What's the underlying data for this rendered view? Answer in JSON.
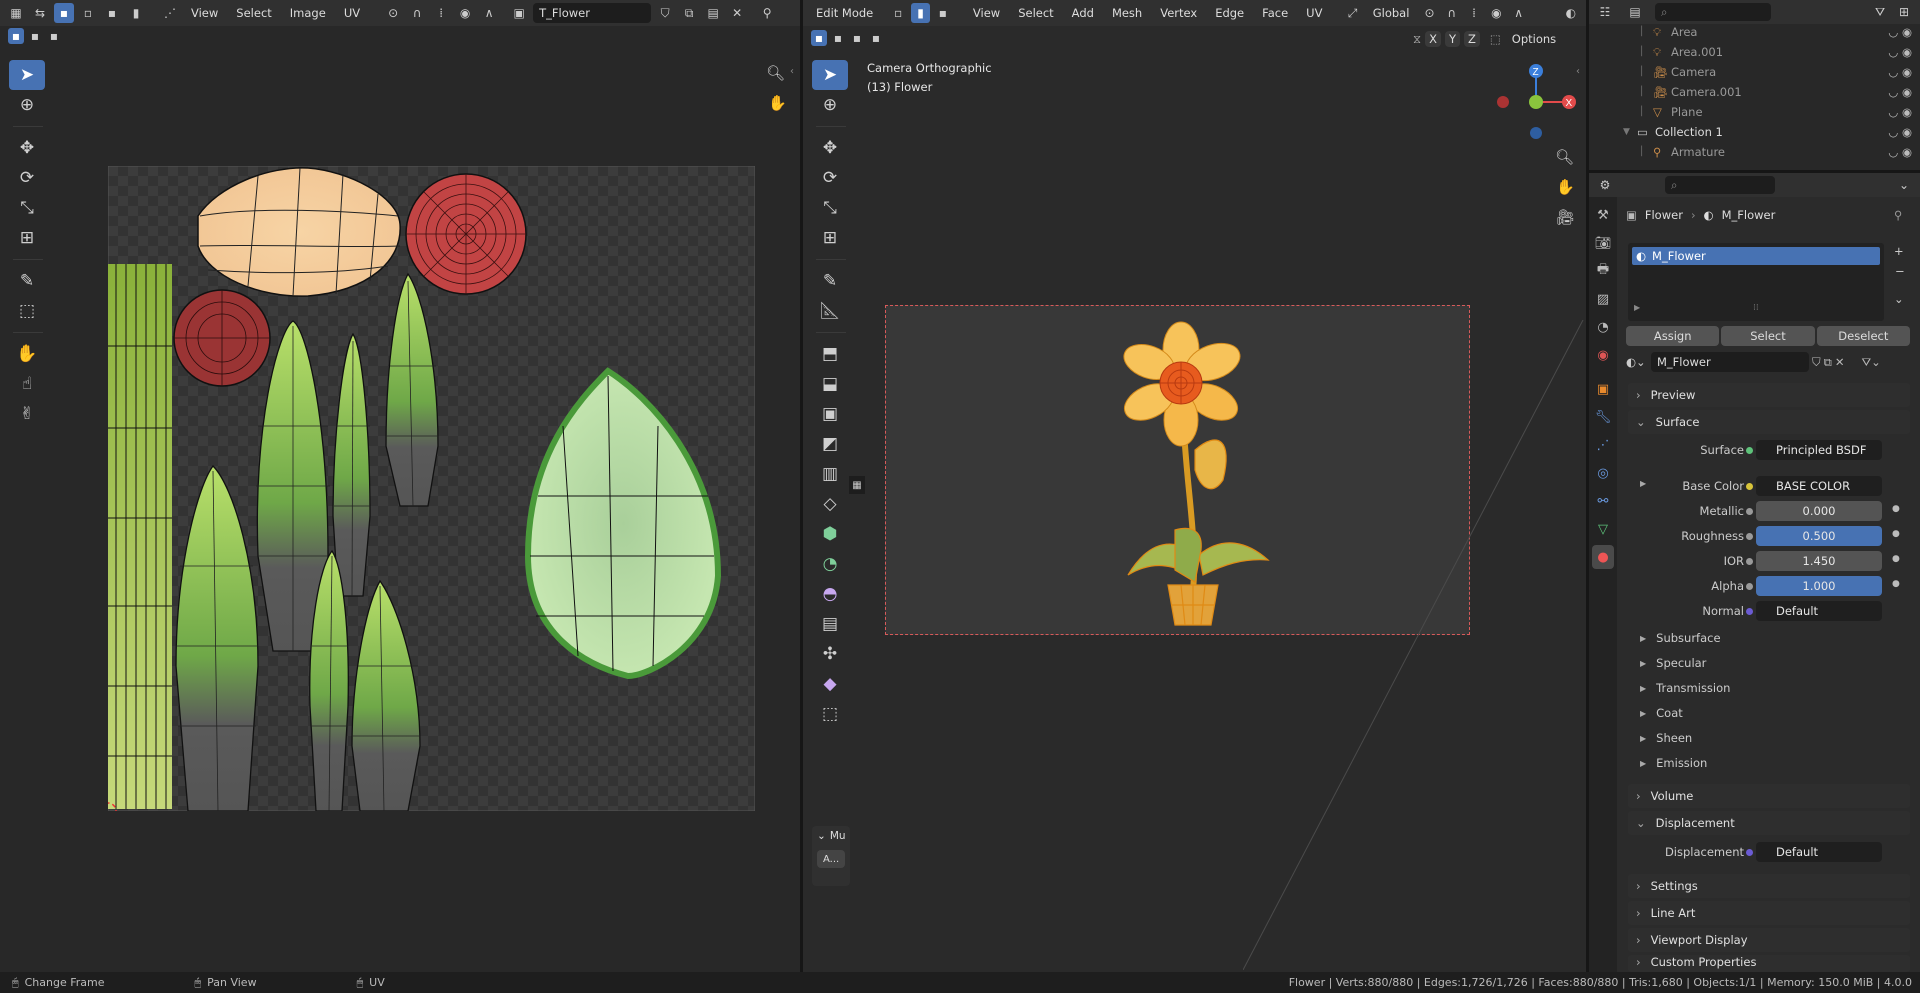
{
  "uv_editor": {
    "menus": [
      "View",
      "Select",
      "Image",
      "UV"
    ],
    "image_name": "T_Flower"
  },
  "viewport": {
    "mode": "Edit Mode",
    "menus": [
      "View",
      "Select",
      "Add",
      "Mesh",
      "Vertex",
      "Edge",
      "Face",
      "UV"
    ],
    "orientation": "Global",
    "options": "Options",
    "axis_x": "X",
    "axis_y": "Y",
    "axis_z": "Z",
    "camera_label": "Camera Orthographic",
    "object_label": "(13) Flower",
    "panel_title": "Mu",
    "panel_button": "A..."
  },
  "outliner": {
    "items": [
      {
        "name": "Area",
        "indent": 1
      },
      {
        "name": "Area.001",
        "indent": 1
      },
      {
        "name": "Camera",
        "indent": 1
      },
      {
        "name": "Camera.001",
        "indent": 1
      },
      {
        "name": "Plane",
        "indent": 1
      },
      {
        "name": "Collection 1",
        "indent": 0
      },
      {
        "name": "Armature",
        "indent": 1
      }
    ]
  },
  "properties": {
    "breadcrumb_object": "Flower",
    "breadcrumb_material": "M_Flower",
    "slot": "M_Flower",
    "assign": "Assign",
    "select": "Select",
    "deselect": "Deselect",
    "material_name": "M_Flower",
    "preview": "Preview",
    "surface_section": "Surface",
    "surface_label": "Surface",
    "surface_value": "Principled BSDF",
    "base_color_label": "Base Color",
    "base_color_value": "BASE COLOR",
    "metallic_label": "Metallic",
    "metallic_value": "0.000",
    "roughness_label": "Roughness",
    "roughness_value": "0.500",
    "ior_label": "IOR",
    "ior_value": "1.450",
    "alpha_label": "Alpha",
    "alpha_value": "1.000",
    "normal_label": "Normal",
    "normal_value": "Default",
    "subsections": [
      "Subsurface",
      "Specular",
      "Transmission",
      "Coat",
      "Sheen",
      "Emission"
    ],
    "volume": "Volume",
    "displacement_section": "Displacement",
    "displacement_label": "Displacement",
    "displacement_value": "Default",
    "settings": "Settings",
    "line_art": "Line Art",
    "viewport_display": "Viewport Display",
    "custom_properties": "Custom Properties"
  },
  "statusbar": {
    "left1": "Change Frame",
    "left2": "Pan View",
    "left3": "UV",
    "right": "Flower | Verts:880/880 | Edges:1,726/1,726 | Faces:880/880 | Tris:1,680 | Objects:1/1 | Memory: 150.0 MiB | 4.0.0"
  },
  "colors": {
    "accent": "#4772b3",
    "header": "#303030",
    "panel": "#2b2b2b"
  }
}
